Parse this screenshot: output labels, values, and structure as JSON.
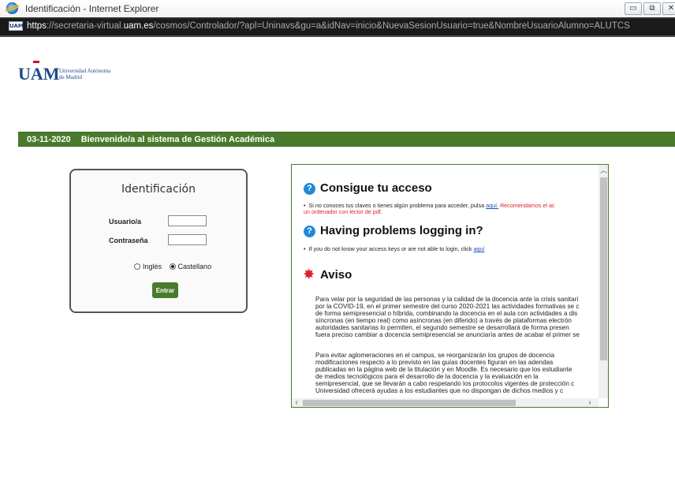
{
  "window": {
    "title": "Identificación - Internet Explorer",
    "controls": [
      "minimize",
      "maximize",
      "close"
    ]
  },
  "address": {
    "scheme": "https",
    "pre_domain": "://secretaria-virtual.",
    "domain": "uam.es",
    "path": "/cosmos/Controlador/?apl=Uninavs&gu=a&idNav=inicio&NuevaSesionUsuario=true&NombreUsuarioAlumno=ALUTCS"
  },
  "logo": {
    "letters_u": "U",
    "letters_a": "A",
    "letters_m": "M",
    "line1": "Universidad Autónoma",
    "line2": "de Madrid"
  },
  "banner": {
    "date": "03-11-2020",
    "welcome": "Bienvenido/a al sistema de Gestión Académica",
    "color": "#4a7a2c"
  },
  "login": {
    "title": "Identificación",
    "user_label": "Usuario/a",
    "pass_label": "Contraseña",
    "user_value": "",
    "pass_value": "",
    "lang_en": "Inglés",
    "lang_es": "Castellano",
    "selected_lang": "Castellano",
    "submit": "Entrar"
  },
  "info": {
    "access_title": "Consigue tu acceso",
    "access_text": "Si no conoces tus claves o tienes algún problema para acceder, pulsa",
    "access_link": "aquí.",
    "access_red_1": "Recomendamos el ac",
    "access_red_2": "un ordenador con lector de pdf.",
    "help_title": "Having problems logging in?",
    "help_text": "If you do not know your access keys or are not able to login, click",
    "help_link": "aquí",
    "notice_title": "Aviso",
    "para1": [
      "Para velar por la seguridad de las personas y la calidad de la docencia ante la crisis sanitari",
      "por la COVID-19, en el primer semestre del curso 2020-2021 las actividades formativas se c",
      "de forma semipresencial o híbrida, combinando la docencia en el aula con actividades a dis",
      "síncronas (en tiempo real) como asíncronas (en diferido) a través de plataformas electrón",
      "autoridades sanitarias lo permiten, el segundo semestre se desarrollará de forma presen",
      "fuera preciso cambiar a docencia semipresencial se anunciaría antes de acabar el primer se"
    ],
    "para2": [
      "Para evitar aglomeraciones en el campus, se reorganizarán los grupos de docencia",
      "modificaciones respecto a lo previsto en las guías docentes figuran en las adendas",
      "publicadas en la página web de la titulación y en Moodle. Es necesario que los estudiante",
      "de medios tecnológicos para el desarrollo de la docencia y la evaluación en la",
      "semipresencial, que se llevarán a cabo respetando los protocolos vigentes de protección c",
      "Universidad ofrecerá ayudas a los estudiantes que no dispongan de dichos medios y c"
    ]
  }
}
